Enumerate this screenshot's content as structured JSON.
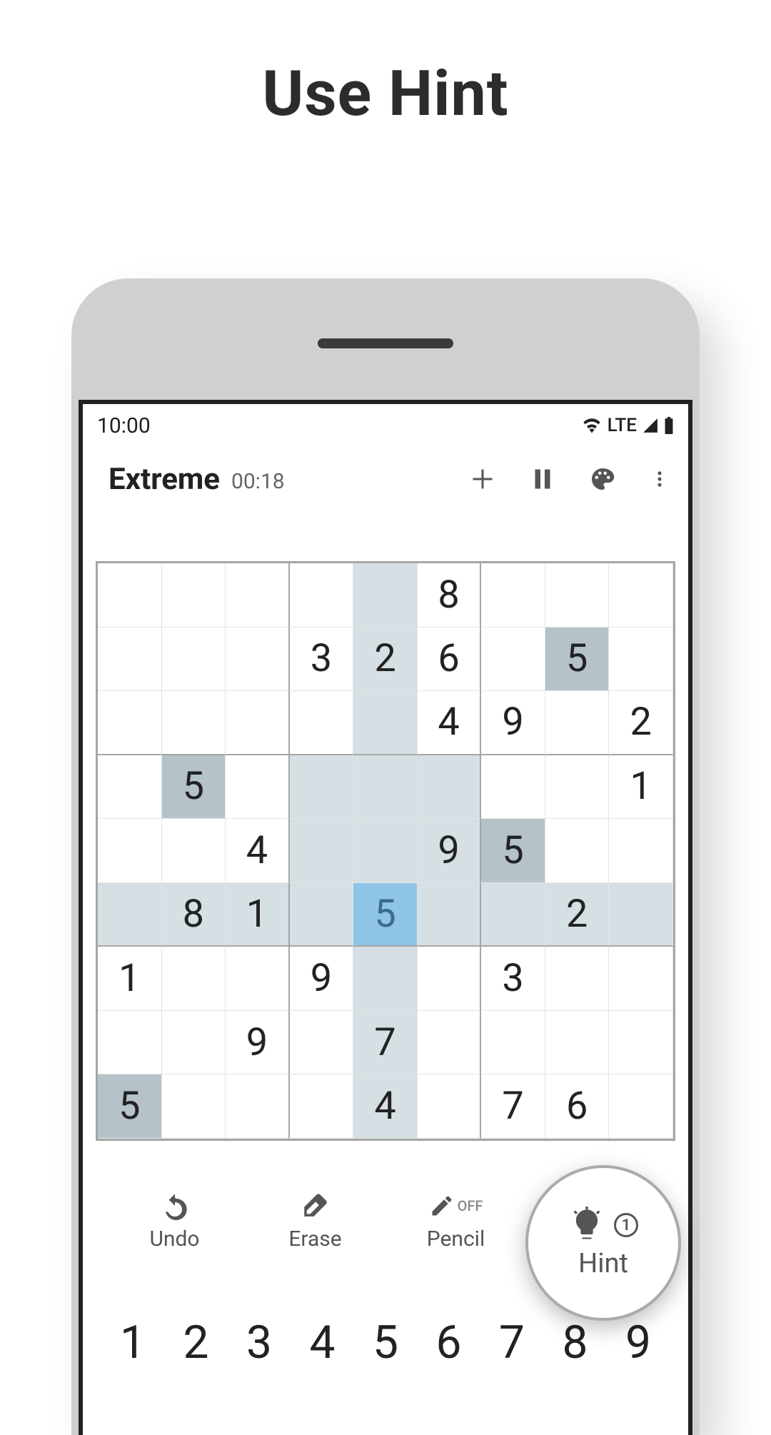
{
  "page": {
    "title": "Use Hint"
  },
  "status": {
    "time": "10:00",
    "network": "LTE"
  },
  "header": {
    "difficulty": "Extreme",
    "timer": "00:18"
  },
  "board": {
    "selected": {
      "row": 5,
      "col": 4
    },
    "grid": [
      [
        "",
        "",
        "",
        "",
        "",
        "8",
        "",
        "",
        ""
      ],
      [
        "",
        "",
        "",
        "3",
        "2",
        "6",
        "",
        "5",
        ""
      ],
      [
        "",
        "",
        "",
        "",
        "",
        "4",
        "9",
        "",
        "2"
      ],
      [
        "",
        "5",
        "",
        "",
        "",
        "",
        "",
        "",
        "1"
      ],
      [
        "",
        "",
        "4",
        "",
        "",
        "9",
        "5",
        "",
        ""
      ],
      [
        "",
        "8",
        "1",
        "",
        "5",
        "",
        "",
        "2",
        ""
      ],
      [
        "1",
        "",
        "",
        "9",
        "",
        "",
        "3",
        "",
        ""
      ],
      [
        "",
        "",
        "9",
        "",
        "7",
        "",
        "",
        "",
        ""
      ],
      [
        "5",
        "",
        "",
        "",
        "4",
        "",
        "7",
        "6",
        ""
      ]
    ],
    "user_entries": [
      [
        5,
        4
      ]
    ],
    "same_highlights": [
      [
        1,
        7
      ],
      [
        3,
        1
      ],
      [
        4,
        6
      ],
      [
        8,
        0
      ]
    ]
  },
  "actions": {
    "undo": "Undo",
    "erase": "Erase",
    "pencil": "Pencil",
    "pencil_state": "OFF",
    "hint": "Hint",
    "hint_count": "1"
  },
  "numpad": [
    "1",
    "2",
    "3",
    "4",
    "5",
    "6",
    "7",
    "8",
    "9"
  ]
}
